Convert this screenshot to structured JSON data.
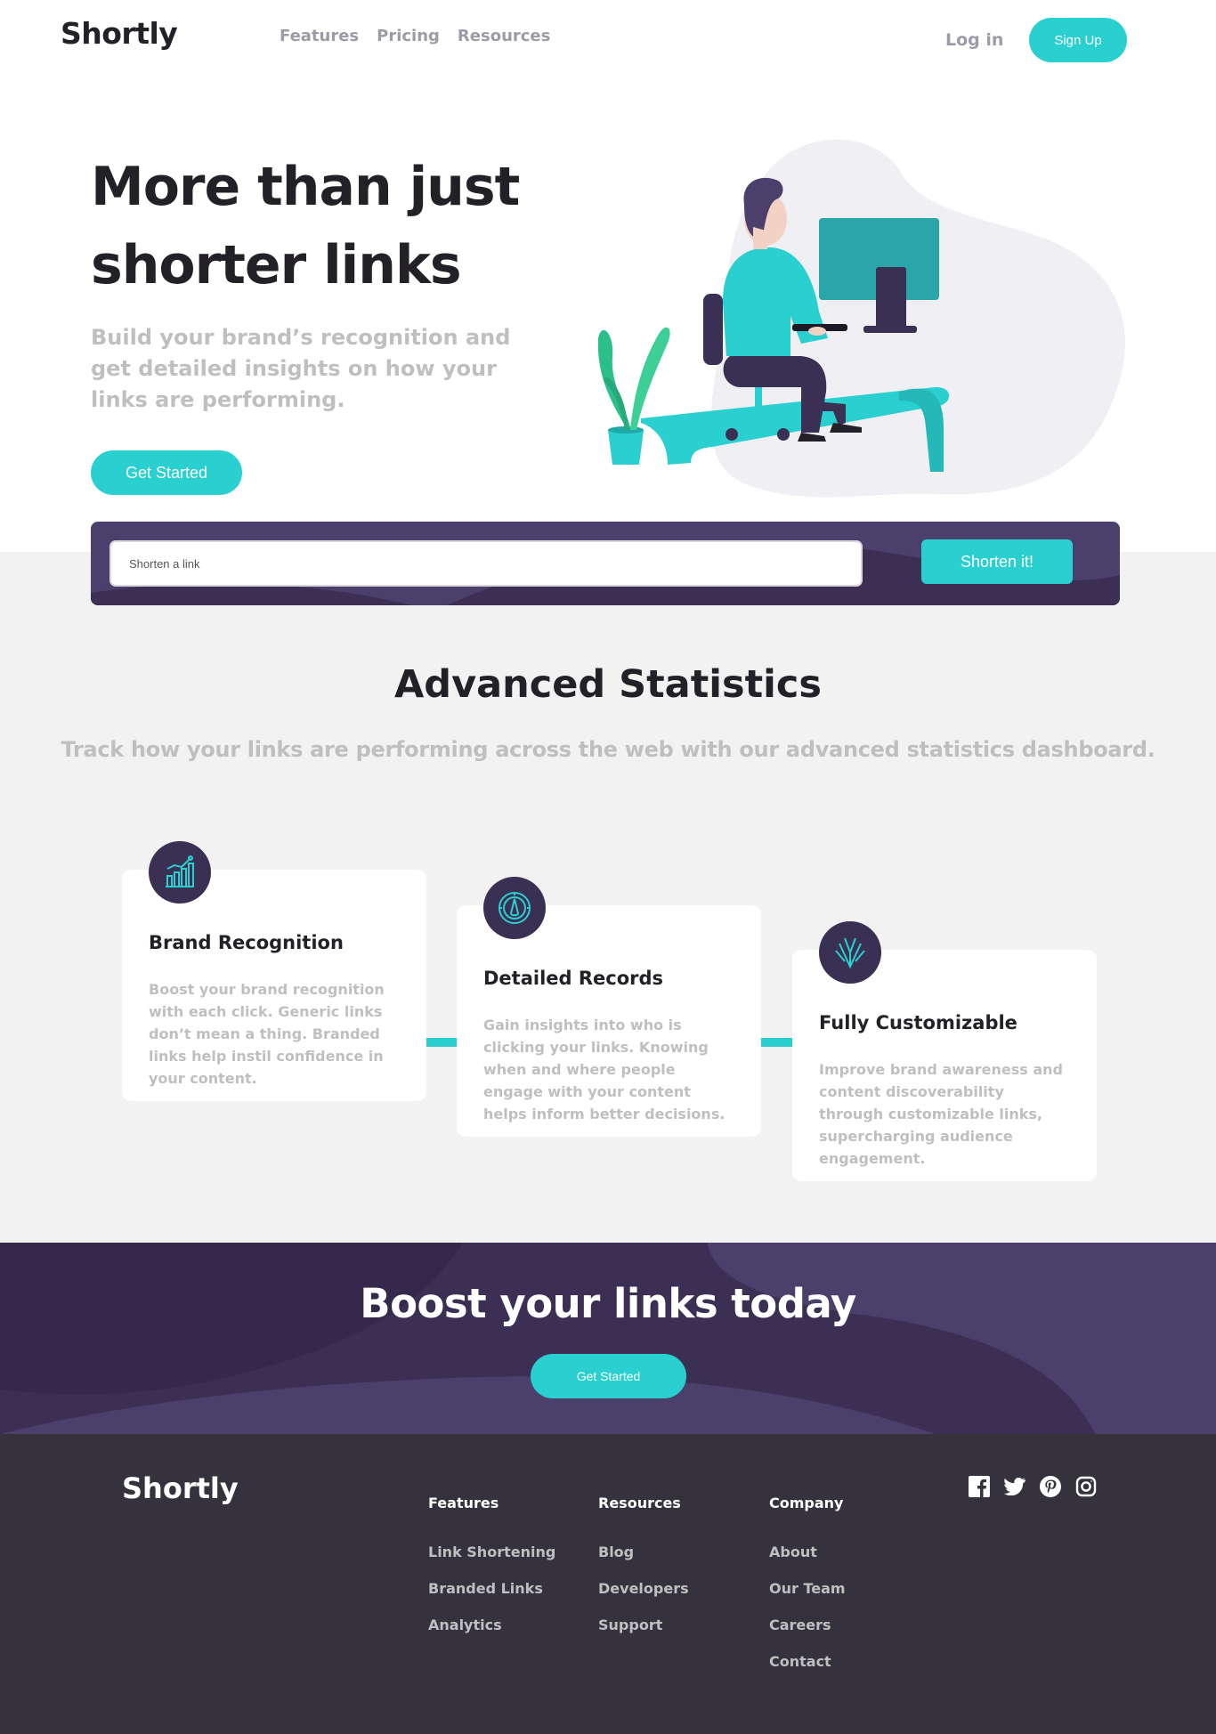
{
  "header": {
    "logo": "Shortly",
    "nav": [
      "Features",
      "Pricing",
      "Resources"
    ],
    "login": "Log in",
    "signup": "Sign Up"
  },
  "hero": {
    "title": "More than just shorter links",
    "subtitle": "Build your brand’s recognition and get detailed insights on how your links are performing.",
    "cta": "Get Started"
  },
  "shorten": {
    "placeholder": "Shorten a link",
    "button": "Shorten it!"
  },
  "stats": {
    "title": "Advanced Statistics",
    "subtitle": "Track how your links are performing across the web with our advanced statistics dashboard.",
    "cards": [
      {
        "icon": "brand-recognition-icon",
        "title": "Brand Recognition",
        "text": "Boost your brand recognition with each click. Generic links don’t mean a thing. Branded links help instil confidence in your content."
      },
      {
        "icon": "detailed-records-icon",
        "title": "Detailed Records",
        "text": "Gain insights into who is clicking your links. Knowing when and where people engage with your content helps inform better decisions."
      },
      {
        "icon": "fully-customizable-icon",
        "title": "Fully Customizable",
        "text": "Improve brand awareness and content discoverability through customizable links, supercharging audience engagement."
      }
    ]
  },
  "boost": {
    "title": "Boost your links today",
    "cta": "Get Started"
  },
  "footer": {
    "logo": "Shortly",
    "columns": [
      {
        "heading": "Features",
        "links": [
          "Link Shortening",
          "Branded Links",
          "Analytics"
        ]
      },
      {
        "heading": "Resources",
        "links": [
          "Blog",
          "Developers",
          "Support"
        ]
      },
      {
        "heading": "Company",
        "links": [
          "About",
          "Our Team",
          "Careers",
          "Contact"
        ]
      }
    ],
    "socials": [
      "facebook-icon",
      "twitter-icon",
      "pinterest-icon",
      "instagram-icon"
    ]
  },
  "colors": {
    "primary": "#2acfcf",
    "dark_violet": "#3b3054",
    "grayish_violet": "#9e9aa7",
    "very_dark_blue": "#35323e",
    "very_dark_violet": "#232127",
    "light_gray": "#f2f2f2"
  }
}
